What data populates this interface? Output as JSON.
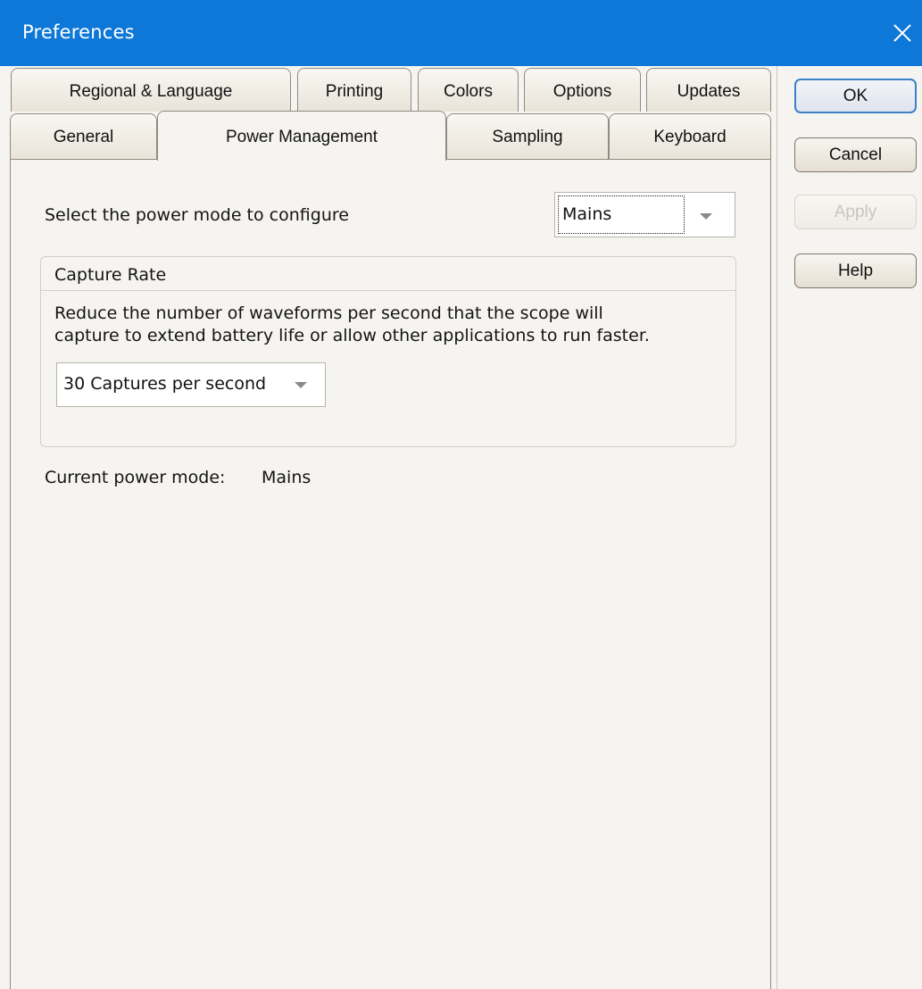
{
  "window": {
    "title": "Preferences"
  },
  "tabs": {
    "row1": [
      "Regional & Language",
      "Printing",
      "Colors",
      "Options",
      "Updates"
    ],
    "row2": [
      "General",
      "Power Management",
      "Sampling",
      "Keyboard"
    ],
    "active": "Power Management"
  },
  "power": {
    "select_label": "Select the power mode to configure",
    "mode_value": "Mains",
    "group_title": "Capture Rate",
    "description_line1": "Reduce the number of waveforms per second that the scope will",
    "description_line2": "capture to extend battery life or allow other applications to run faster.",
    "capture_rate_value": "30 Captures per second",
    "current_mode_label": "Current power mode:",
    "current_mode_value": "Mains"
  },
  "buttons": {
    "ok": "OK",
    "cancel": "Cancel",
    "apply": "Apply",
    "help": "Help"
  },
  "colors": {
    "titlebar": "#0d78d7",
    "background": "#f6f4f0",
    "default_button_border": "#3c80c9"
  }
}
